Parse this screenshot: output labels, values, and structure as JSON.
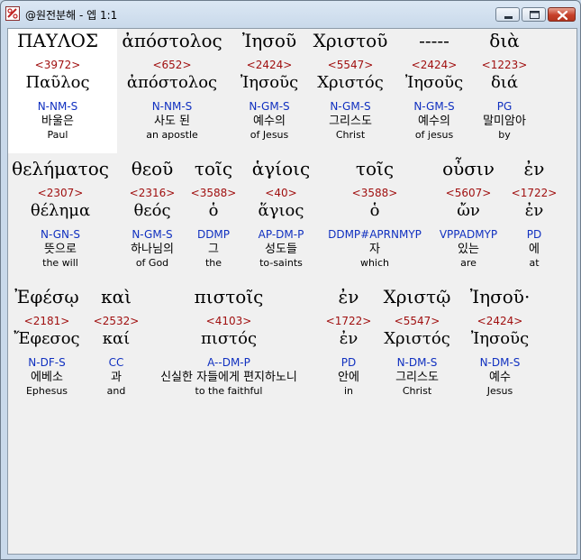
{
  "window": {
    "title": "@원전분해 - 엡 1:1",
    "buttons": {
      "minimize": "minimize-icon",
      "maximize": "maximize-icon",
      "close": "close-icon"
    }
  },
  "rows": [
    {
      "words": [
        {
          "greek": "ΠΑΥΛΟΣ",
          "strong": "<3972>",
          "lemma": "Παῦλος",
          "parse": "N-NM-S",
          "korean": "바울은",
          "english": "Paul"
        },
        {
          "greek": "ἀπόστολος",
          "strong": "<652>",
          "lemma": "ἀπόστολος",
          "parse": "N-NM-S",
          "korean": "사도 된",
          "english": "an apostle"
        },
        {
          "greek": "Ἰησοῦ",
          "strong": "<2424>",
          "lemma": "Ἰησοῦς",
          "parse": "N-GM-S",
          "korean": "예수의",
          "english": "of Jesus"
        },
        {
          "greek": "Χριστοῦ",
          "strong": "<5547>",
          "lemma": "Χριστός",
          "parse": "N-GM-S",
          "korean": "그리스도",
          "english": "Christ"
        },
        {
          "greek": "-----",
          "strong": "<2424>",
          "lemma": "Ἰησοῦς",
          "parse": "N-GM-S",
          "korean": "예수의",
          "english": "of jesus"
        },
        {
          "greek": "διὰ",
          "strong": "<1223>",
          "lemma": "διά",
          "parse": "PG",
          "korean": "말미암아",
          "english": "by"
        }
      ]
    },
    {
      "words": [
        {
          "greek": "θελήματος",
          "strong": "<2307>",
          "lemma": "θέλημα",
          "parse": "N-GN-S",
          "korean": "뜻으로",
          "english": "the will"
        },
        {
          "greek": "θεοῦ",
          "strong": "<2316>",
          "lemma": "θεός",
          "parse": "N-GM-S",
          "korean": "하나님의",
          "english": "of God"
        },
        {
          "greek": "τοῖς",
          "strong": "<3588>",
          "lemma": "ὁ",
          "parse": "DDMP",
          "korean": "그",
          "english": "the"
        },
        {
          "greek": "ἁγίοις",
          "strong": "<40>",
          "lemma": "ἅγιος",
          "parse": "AP-DM-P",
          "korean": "성도들",
          "english": "to-saints"
        },
        {
          "greek": "τοῖς",
          "strong": "<3588>",
          "lemma": "ὁ",
          "parse": "DDMP#APRNMYP",
          "korean": "자",
          "english": "which"
        },
        {
          "greek": "οὖσιν",
          "strong": "<5607>",
          "lemma": "ὤν",
          "parse": "VPPADMYP",
          "korean": "있는",
          "english": "are"
        },
        {
          "greek": "ἐν",
          "strong": "<1722>",
          "lemma": "ἐν",
          "parse": "PD",
          "korean": "에",
          "english": "at"
        }
      ]
    },
    {
      "words": [
        {
          "greek": "Ἐφέσῳ",
          "strong": "<2181>",
          "lemma": "Ἔφεσος",
          "parse": "N-DF-S",
          "korean": "에베소",
          "english": "Ephesus"
        },
        {
          "greek": "καὶ",
          "strong": "<2532>",
          "lemma": "καί",
          "parse": "CC",
          "korean": "과",
          "english": "and"
        },
        {
          "greek": "πιστοῖς",
          "strong": "<4103>",
          "lemma": "πιστός",
          "parse": "A--DM-P",
          "korean": "신실한 자들에게 편지하노니",
          "english": "to the faithful"
        },
        {
          "greek": "ἐν",
          "strong": "<1722>",
          "lemma": "ἐν",
          "parse": "PD",
          "korean": "안에",
          "english": "in"
        },
        {
          "greek": "Χριστῷ",
          "strong": "<5547>",
          "lemma": "Χριστός",
          "parse": "N-DM-S",
          "korean": "그리스도",
          "english": "Christ"
        },
        {
          "greek": "Ἰησοῦ·",
          "strong": "<2424>",
          "lemma": "Ἰησοῦς",
          "parse": "N-DM-S",
          "korean": "예수",
          "english": "Jesus"
        }
      ]
    }
  ]
}
